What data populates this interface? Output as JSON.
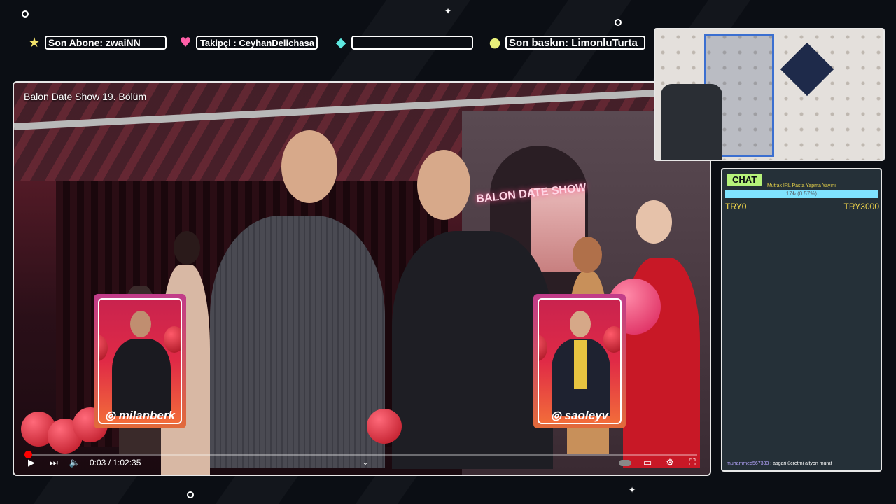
{
  "ticker": {
    "last_sub": "Son Abone: zwaiNN",
    "last_follower": "Son Takipçi : CeyhanDelichasa",
    "last_donation": "",
    "last_raid": "Son baskın: LimonluTurta"
  },
  "video": {
    "title": "Balon Date Show 19. Bölüm",
    "neon_sign": "BALON DATE SHOW",
    "time": "0:03 / 1:02:35",
    "progress_percent": 0.1
  },
  "cards": [
    {
      "handle": "milanberk"
    },
    {
      "handle": "saoleyv"
    }
  ],
  "chat": {
    "label": "CHAT",
    "goal_title": "Mutfak IRL Pasta Yapma Yayını",
    "goal_progress": "17₺ (0.57%)",
    "goal_min": "TRY0",
    "goal_max": "TRY3000",
    "message_user": "muhammed567333",
    "message_text": "asgari ücretmi altyon murat"
  },
  "colors": {
    "accent_green": "#b6f27a",
    "goal_bar": "#7fe3ff",
    "goal_text": "#f2d64a",
    "youtube_red": "#ff0000"
  },
  "icons": {
    "sub": "star-icon",
    "follower": "heart-icon",
    "donation": "diamond-icon",
    "raid": "lemon-icon"
  }
}
